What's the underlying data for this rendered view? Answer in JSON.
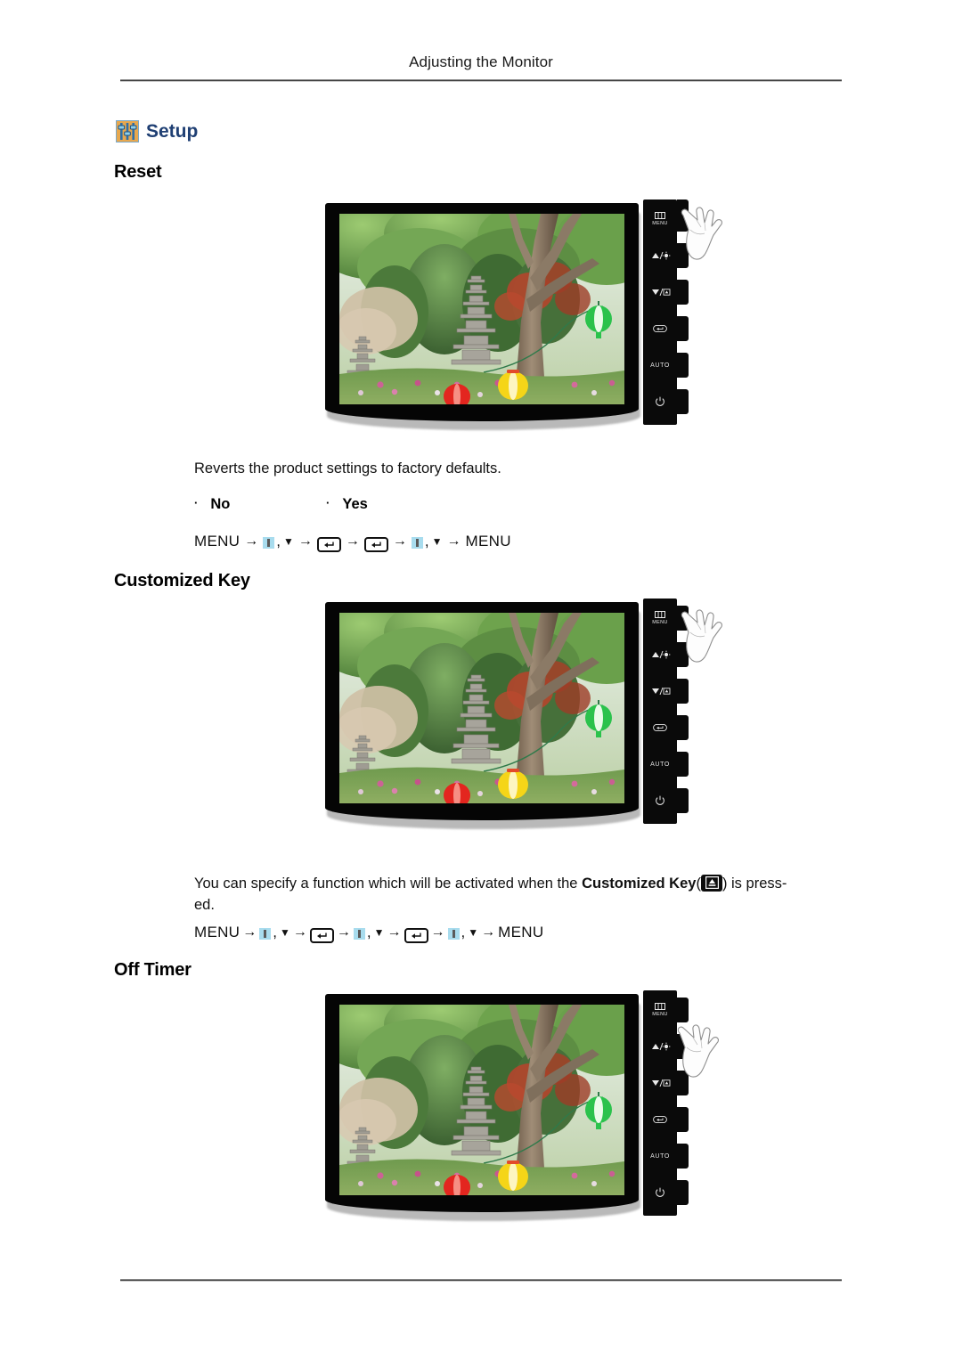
{
  "header": {
    "title": "Adjusting the Monitor"
  },
  "setup": {
    "label": "Setup",
    "icon": "sliders-icon",
    "icon_bg": "#e8a84e",
    "icon_fg": "#2f6fa8",
    "label_color": "#1f3f73"
  },
  "sections": [
    {
      "id": "reset",
      "heading": "Reset",
      "description": "Reverts the product settings to factory defaults.",
      "options": [
        "No",
        "Yes"
      ],
      "key_sequence": [
        "MENU",
        "→",
        "blue-square-icon",
        ",",
        "▼",
        "→",
        "enter-icon",
        "→",
        "enter-icon",
        "→",
        "blue-square-icon",
        ",",
        "▼",
        "→",
        "MENU"
      ],
      "monitor": {
        "hand_target": "menu-button",
        "buttons": [
          {
            "name": "menu-button",
            "glyph": "▥",
            "label": "MENU"
          },
          {
            "name": "brightness-up-button",
            "glyph": "▲/☀",
            "label": ""
          },
          {
            "name": "customized-key-button",
            "glyph": "▼/⧉",
            "label": ""
          },
          {
            "name": "enter-button",
            "glyph": "⏎",
            "label": ""
          },
          {
            "name": "auto-button",
            "glyph": "",
            "label": "AUTO"
          },
          {
            "name": "power-button",
            "glyph": "⏻",
            "label": ""
          }
        ]
      }
    },
    {
      "id": "customized-key",
      "heading": "Customized Key",
      "description_prefix": "You can specify a function which will be activated when the ",
      "description_bold": "Customized Key",
      "description_suffix": ") is press-",
      "description_line2": "ed.",
      "key_sequence": [
        "MENU",
        "→",
        "blue-square-icon",
        ",",
        "▼",
        "→",
        "enter-icon",
        "→",
        "blue-square-icon",
        ",",
        "▼",
        "→",
        "enter-icon",
        "→",
        "blue-square-icon",
        ",",
        "▼",
        "→",
        "MENU"
      ],
      "monitor": {
        "hand_target": "menu-button",
        "buttons": [
          {
            "name": "menu-button",
            "glyph": "▥",
            "label": "MENU"
          },
          {
            "name": "brightness-up-button",
            "glyph": "▲/☀",
            "label": ""
          },
          {
            "name": "customized-key-button",
            "glyph": "▼/⧉",
            "label": ""
          },
          {
            "name": "enter-button",
            "glyph": "⏎",
            "label": ""
          },
          {
            "name": "auto-button",
            "glyph": "",
            "label": "AUTO"
          },
          {
            "name": "power-button",
            "glyph": "⏻",
            "label": ""
          }
        ]
      }
    },
    {
      "id": "off-timer",
      "heading": "Off Timer",
      "monitor": {
        "hand_target": "menu-button",
        "buttons": [
          {
            "name": "menu-button",
            "glyph": "▥",
            "label": "MENU"
          },
          {
            "name": "brightness-up-button",
            "glyph": "▲/☀",
            "label": ""
          },
          {
            "name": "customized-key-button",
            "glyph": "▼/⧉",
            "label": ""
          },
          {
            "name": "enter-button",
            "glyph": "⏎",
            "label": ""
          },
          {
            "name": "auto-button",
            "glyph": "",
            "label": "AUTO"
          },
          {
            "name": "power-button",
            "glyph": "⏻",
            "label": ""
          }
        ]
      }
    }
  ],
  "labels": {
    "menu_word": "MENU",
    "arrow": "→",
    "down_triangle": "▼",
    "comma": ",",
    "bullet": "·",
    "open_paren": "(",
    "close_paren": ")",
    "auto": "AUTO"
  },
  "colors": {
    "bezel": "#050505",
    "blue_icon": "#a8dcee",
    "setup_title": "#1f3f73",
    "rule": "#3d3d3d"
  }
}
